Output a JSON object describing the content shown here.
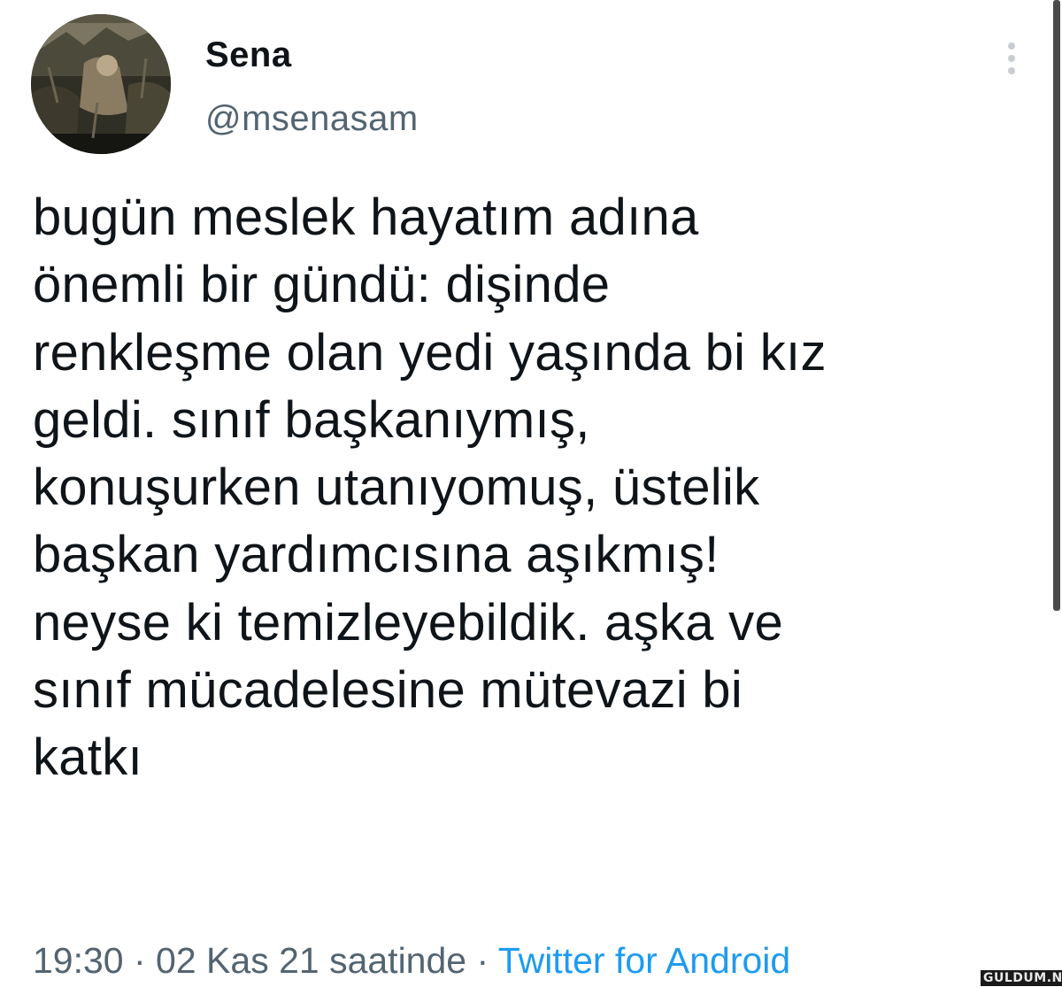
{
  "tweet": {
    "author": {
      "display_name": "Sena",
      "handle": "@msenasam",
      "avatar_icon": "profile-photo"
    },
    "more_icon": "more-vertical-icon",
    "text_lines": [
      "bugün meslek hayatım adına",
      "önemli bir gündü: dişinde",
      "renkleşme olan yedi yaşında bi kız",
      "geldi. sınıf başkanıymış,",
      "konuşurken utanıyomuş, üstelik",
      "başkan yardımcısına aşıkmış!",
      "neyse ki temizleyebildik. aşka ve",
      "sınıf mücadelesine mütevazi bi",
      "katkı"
    ],
    "meta": {
      "time": "19:30",
      "separator": " · ",
      "date_text": "02 Kas 21 saatinde",
      "source": "Twitter for Android"
    }
  },
  "watermark": "GULDUM.NET",
  "colors": {
    "text_primary": "#0f1419",
    "text_secondary": "#536471",
    "link": "#1d9bf0",
    "background": "#ffffff"
  }
}
